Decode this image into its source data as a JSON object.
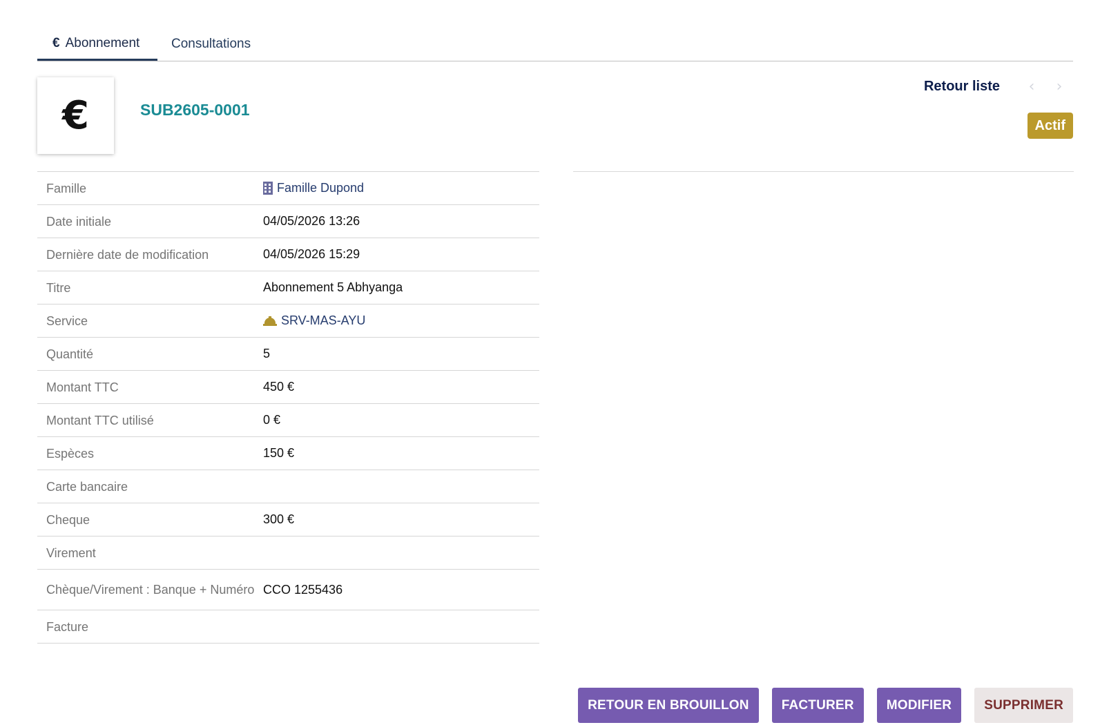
{
  "tabs": [
    {
      "label": "Abonnement",
      "icon": "euro-icon",
      "active": true
    },
    {
      "label": "Consultations",
      "active": false
    }
  ],
  "header": {
    "logo_glyph": "€",
    "reference": "SUB2605-0001",
    "back_label": "Retour liste",
    "status": "Actif"
  },
  "fields": [
    {
      "label": "Famille",
      "value": "Famille Dupond"
    },
    {
      "label": "Date initiale",
      "value": "04/05/2026 13:26"
    },
    {
      "label": "Dernière date de modification",
      "value": "04/05/2026 15:29"
    },
    {
      "label": "Titre",
      "value": "Abonnement 5 Abhyanga"
    },
    {
      "label": "Service",
      "value": "SRV-MAS-AYU"
    },
    {
      "label": "Quantité",
      "value": "5"
    },
    {
      "label": "Montant TTC",
      "value": "450 €"
    },
    {
      "label": "Montant TTC utilisé",
      "value": "0 €"
    },
    {
      "label": "Espèces",
      "value": "150 €"
    },
    {
      "label": "Carte bancaire",
      "value": ""
    },
    {
      "label": "Cheque",
      "value": "300 €"
    },
    {
      "label": "Virement",
      "value": ""
    },
    {
      "label": "Chèque/Virement : Banque + Numéro",
      "value": "CCO 1255436"
    },
    {
      "label": "Facture",
      "value": ""
    }
  ],
  "actions": {
    "draft": "RETOUR EN BROUILLON",
    "invoice": "FACTURER",
    "edit": "MODIFIER",
    "delete": "SUPPRIMER"
  },
  "colors": {
    "accent": "#765bb0",
    "reference": "#1a8b94",
    "status_badge": "#bb9a2c",
    "nav_dark": "#0c1d4b"
  }
}
